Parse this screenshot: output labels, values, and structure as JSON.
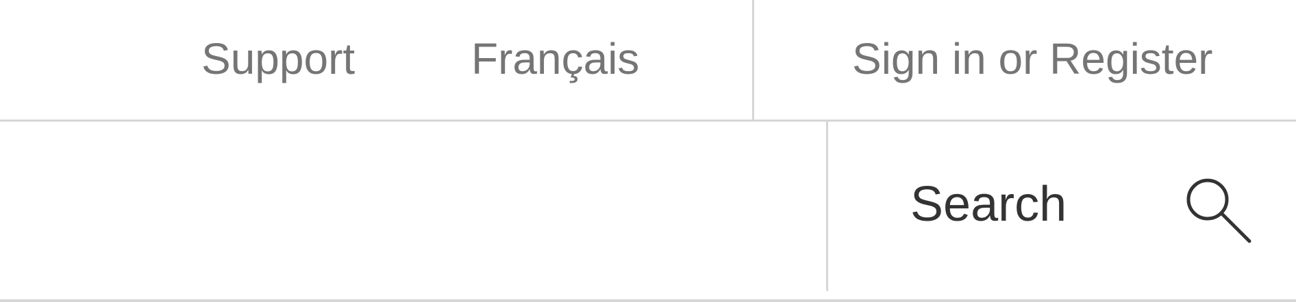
{
  "header": {
    "links": {
      "support": "Support",
      "language": "Français",
      "account": "Sign in or Register"
    }
  },
  "search": {
    "label": "Search",
    "icon": "search-icon"
  },
  "colors": {
    "link_text": "#757575",
    "search_text": "#333333",
    "divider": "#d6d6d6",
    "background": "#ffffff"
  }
}
